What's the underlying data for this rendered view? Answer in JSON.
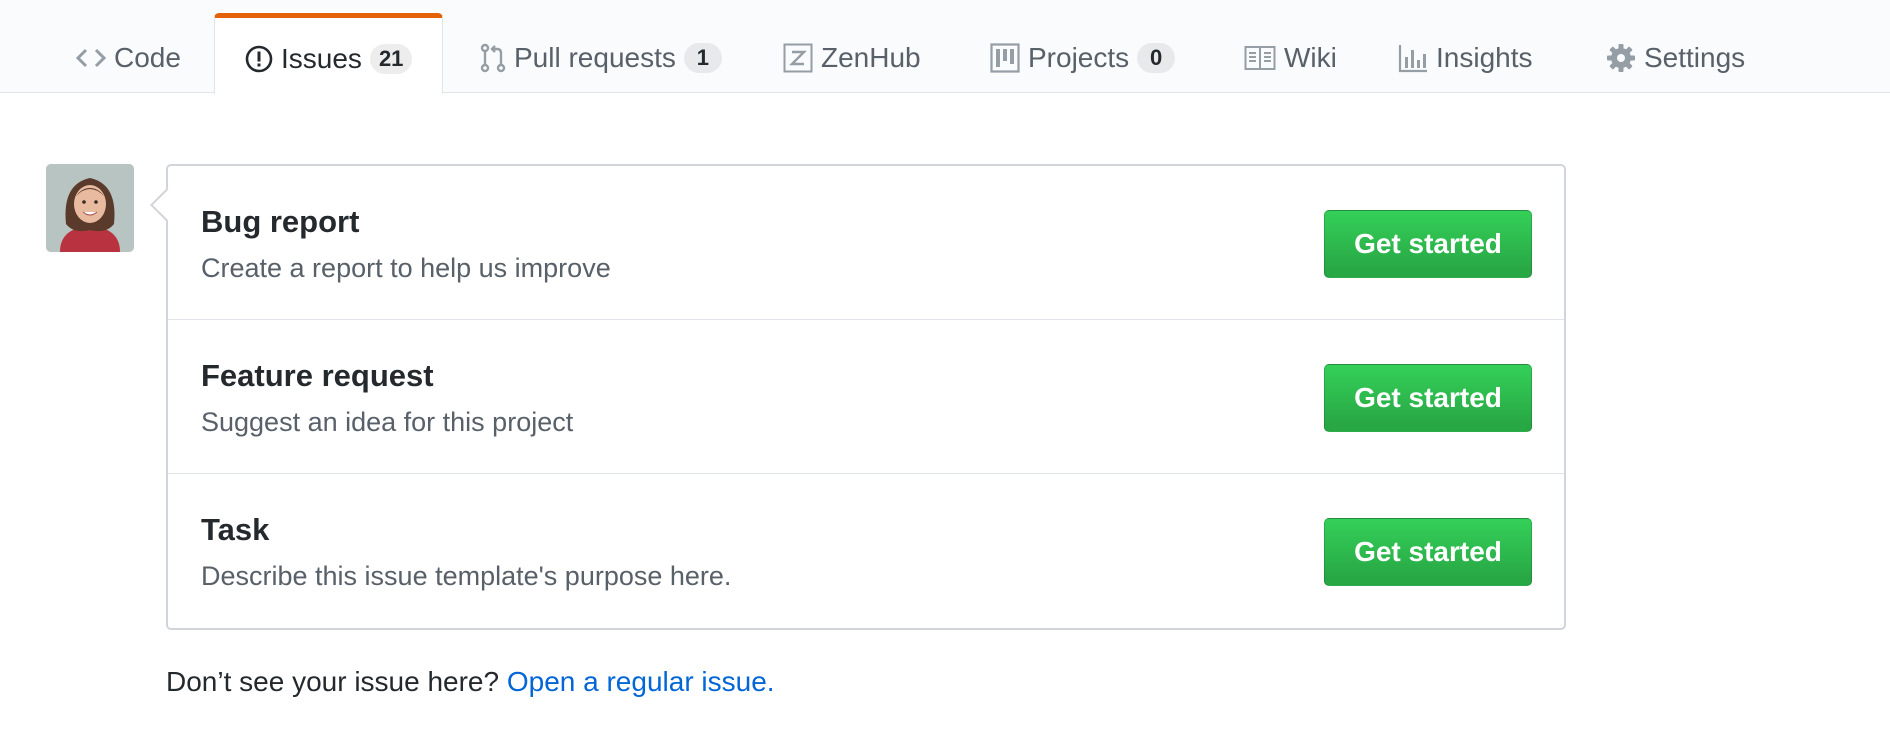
{
  "tabs": [
    {
      "label": "Code",
      "icon": "code-icon"
    },
    {
      "label": "Issues",
      "icon": "issue-opened-icon",
      "count": "21",
      "selected": true
    },
    {
      "label": "Pull requests",
      "icon": "git-pull-request-icon",
      "count": "1"
    },
    {
      "label": "ZenHub",
      "icon": "zenhub-icon"
    },
    {
      "label": "Projects",
      "icon": "project-icon",
      "count": "0"
    },
    {
      "label": "Wiki",
      "icon": "book-icon"
    },
    {
      "label": "Insights",
      "icon": "graph-icon"
    },
    {
      "label": "Settings",
      "icon": "gear-icon"
    }
  ],
  "accent_color": "#e36209",
  "button_color": "#28a745",
  "link_color": "#0366d6",
  "templates": [
    {
      "title": "Bug report",
      "description": "Create a report to help us improve",
      "button": "Get started"
    },
    {
      "title": "Feature request",
      "description": "Suggest an idea for this project",
      "button": "Get started"
    },
    {
      "title": "Task",
      "description": "Describe this issue template's purpose here.",
      "button": "Get started"
    }
  ],
  "footer": {
    "prompt": "Don’t see your issue here?",
    "link": "Open a regular issue."
  }
}
